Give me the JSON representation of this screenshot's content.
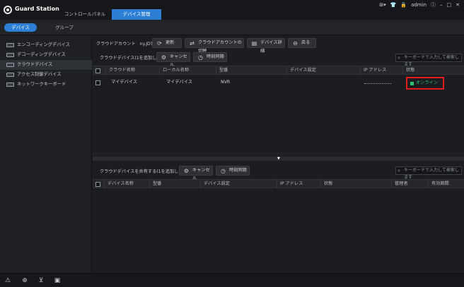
{
  "app": {
    "title": "Guard Station"
  },
  "top_tabs": [
    {
      "label": "コントロールパネル"
    },
    {
      "label": "デバイス管理"
    }
  ],
  "window_tools": {
    "user": "admin"
  },
  "sub_tabs": [
    {
      "label": "デバイス"
    },
    {
      "label": "グループ"
    }
  ],
  "sidebar": {
    "items": [
      {
        "label": "エンコーディングデバイス"
      },
      {
        "label": "デコーディングデバイス"
      },
      {
        "label": "クラウドデバイス"
      },
      {
        "label": "アクセス制御デバイス"
      },
      {
        "label": "ネットワークキーボード"
      }
    ]
  },
  "cloud": {
    "account_label": "クラウドアカウント",
    "account_name": "ny.JDTp",
    "refresh": "更新",
    "switch_account": "クラウドアカウントの切替",
    "device_details": "デバイス詳細",
    "back": "戻る"
  },
  "cloud_devices": {
    "title": "クラウドデバイス(1を追加した)",
    "cancel": "キャンセル",
    "time_sync": "時刻同期",
    "search_placeholder": "キーボードで入力して検索します",
    "columns": [
      "クラウド名称",
      "ローカル名称",
      "型番",
      "デバイス設定",
      "IP アドレス",
      "状態"
    ],
    "rows": [
      {
        "cloud_name": "マイデバイス",
        "local_name": "マイデバイス",
        "model": "NVR",
        "settings": "",
        "status": "オンライン"
      }
    ]
  },
  "shared_devices": {
    "title": "クラウドデバイスを共有する(1を追加した)",
    "cancel": "キャンセル",
    "time_sync": "時刻同期",
    "search_placeholder": "キーボードで入力して検索します",
    "columns": [
      "デバイス名称",
      "型番",
      "デバイス設定",
      "IP アドレス",
      "状態",
      "管理者",
      "有効期間"
    ]
  },
  "colors": {
    "accent": "#2c7fd4",
    "online": "#28c76f",
    "highlight": "#e21b1b"
  }
}
